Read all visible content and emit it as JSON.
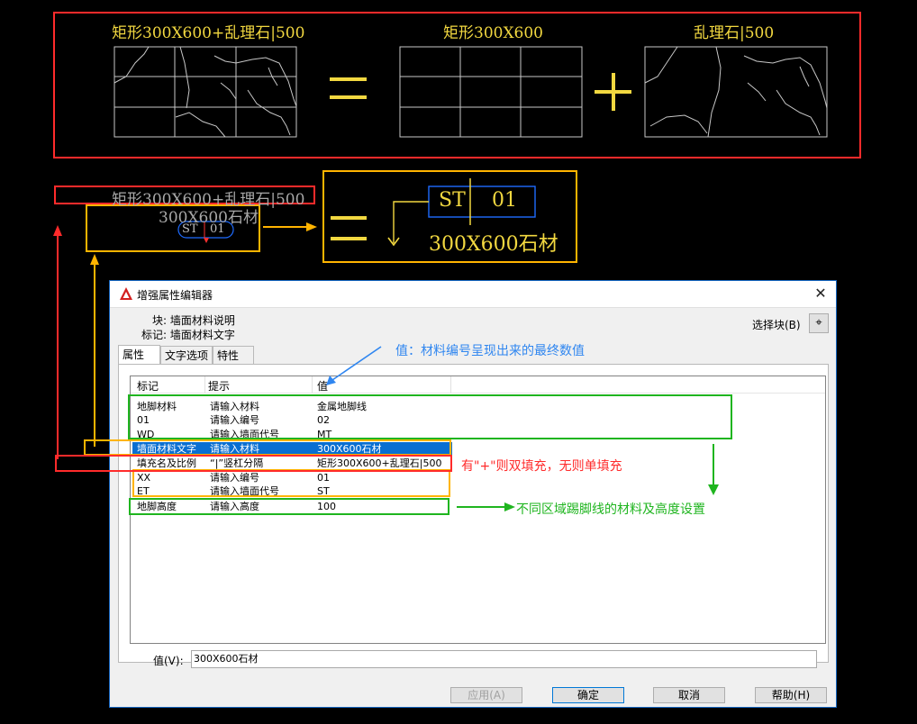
{
  "cad": {
    "top_panel": {
      "label_combined": "矩形300X600+乱理石|500",
      "label_rect": "矩形300X600",
      "label_stone": "乱理石|500",
      "equals": "=",
      "plus": "+"
    },
    "middle": {
      "hatch_label": "矩形300X600+乱理石|500",
      "material_text": "300X600石材",
      "tag_code": "ST",
      "tag_number": "01"
    },
    "result": {
      "equals": "=",
      "tag_code": "ST",
      "tag_number": "01",
      "material_text": "300X600石材"
    },
    "colors": {
      "red": "#ff2b2b",
      "orange": "#ffb400",
      "yellow": "#f2d840",
      "blue": "#1e6bff",
      "green": "#1fb51f"
    }
  },
  "dialog": {
    "title": "增强属性编辑器",
    "block_label": "块: 墙面材料说明",
    "tag_label": "标记: 墙面材料文字",
    "select_block": "选择块(B)",
    "tabs": [
      "属性",
      "文字选项",
      "特性"
    ],
    "columns": [
      "标记",
      "提示",
      "值"
    ],
    "rows": [
      {
        "tag": "地脚材料",
        "prompt": "请输入材料",
        "value": "金属地脚线"
      },
      {
        "tag": "01",
        "prompt": "请输入编号",
        "value": "02"
      },
      {
        "tag": "WD",
        "prompt": "请输入墙面代号",
        "value": "MT"
      },
      {
        "tag": "墙面材料文字",
        "prompt": "请输入材料",
        "value": "300X600石材",
        "selected": true
      },
      {
        "tag": "填充名及比例",
        "prompt": "“|”竖杠分隔",
        "value": "矩形300X600+乱理石|500"
      },
      {
        "tag": "XX",
        "prompt": "请输入编号",
        "value": "01"
      },
      {
        "tag": "ET",
        "prompt": "请输入墙面代号",
        "value": "ST"
      },
      {
        "tag": "地脚高度",
        "prompt": "请输入高度",
        "value": "100"
      }
    ],
    "value_label": "值(V):",
    "value_field": "300X600石材",
    "buttons": {
      "apply": "应用(A)",
      "ok": "确定",
      "cancel": "取消",
      "help": "帮助(H)"
    }
  },
  "annotations": {
    "value_note": "值：材料编号呈现出来的最终数值",
    "hatch_note": "有\"+\"则双填充，无则单填充",
    "skirting_note": "不同区域踢脚线的材料及高度设置"
  }
}
